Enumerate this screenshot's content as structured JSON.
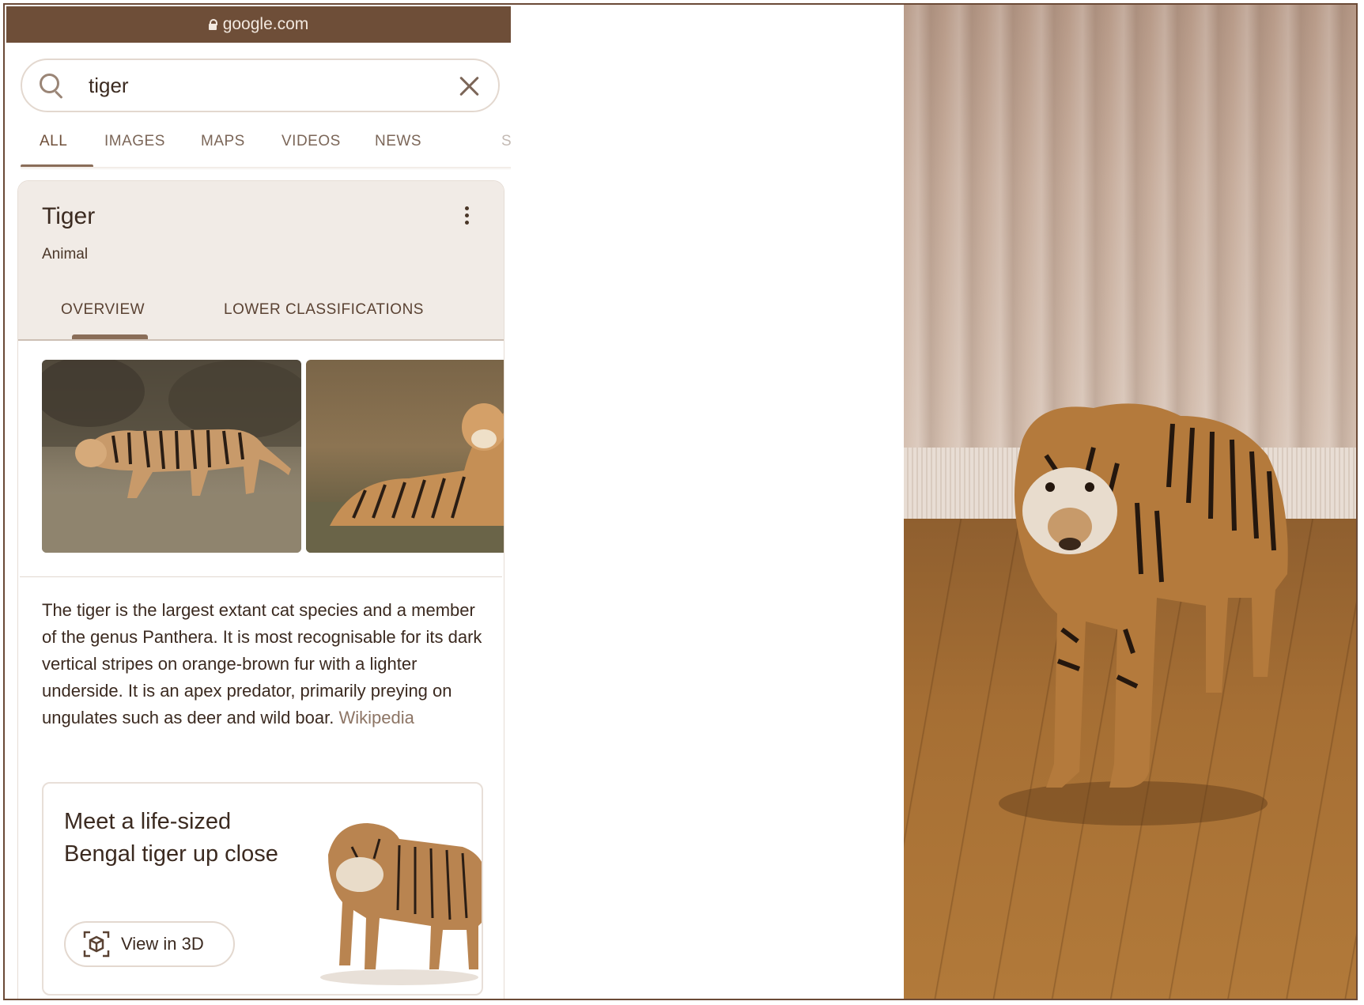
{
  "browser": {
    "url": "google.com"
  },
  "search": {
    "query": "tiger"
  },
  "nav_tabs": [
    {
      "label": "ALL",
      "active": true
    },
    {
      "label": "IMAGES",
      "active": false
    },
    {
      "label": "MAPS",
      "active": false
    },
    {
      "label": "VIDEOS",
      "active": false
    },
    {
      "label": "NEWS",
      "active": false
    },
    {
      "label": "S",
      "active": false
    }
  ],
  "knowledge_panel": {
    "title": "Tiger",
    "subtitle": "Animal",
    "tabs": [
      {
        "label": "OVERVIEW",
        "active": true
      },
      {
        "label": "LOWER CLASSIFICATIONS",
        "active": false
      }
    ],
    "description": "The tiger is the largest extant cat species and a member of the genus Panthera. It is most recognisable for its dark vertical stripes on orange-brown fur with a lighter underside. It is an apex predator, primarily preying on ungulates such as deer and wild boar.",
    "source_link": "Wikipedia",
    "promo": {
      "text": "Meet a life-sized Bengal tiger up close",
      "button_label": "View in 3D"
    }
  },
  "icons": {
    "lock": "lock-icon",
    "search": "search-icon",
    "clear": "close-icon",
    "menu": "more-vert-icon",
    "ar": "3d-cube-icon"
  },
  "colors": {
    "tint": "#6e4e38",
    "background": "#ffffff",
    "text": "#3b2a20"
  }
}
